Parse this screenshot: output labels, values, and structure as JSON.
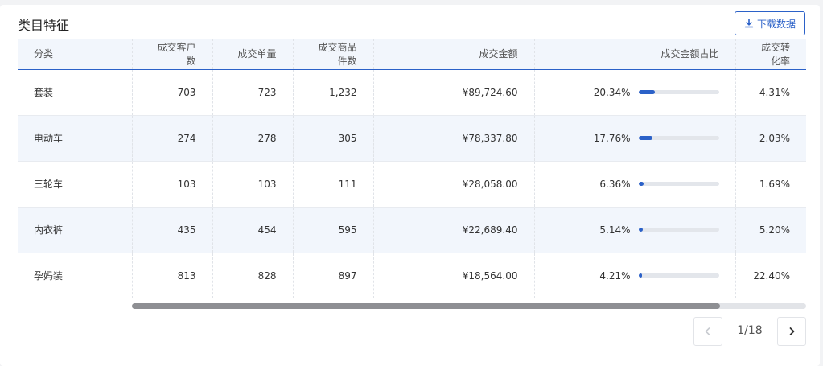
{
  "section": {
    "title": "类目特征",
    "download_label": "下载数据"
  },
  "table": {
    "columns": [
      "分类",
      "成交客户数",
      "成交单量",
      "成交商品件数",
      "成交金额",
      "成交金额占比",
      "成交转化率"
    ],
    "rows": [
      {
        "category": "套装",
        "customers": "703",
        "orders": "723",
        "items": "1,232",
        "amount": "¥89,724.60",
        "share": "20.34%",
        "share_value": 20.34,
        "conversion": "4.31%"
      },
      {
        "category": "电动车",
        "customers": "274",
        "orders": "278",
        "items": "305",
        "amount": "¥78,337.80",
        "share": "17.76%",
        "share_value": 17.76,
        "conversion": "2.03%"
      },
      {
        "category": "三轮车",
        "customers": "103",
        "orders": "103",
        "items": "111",
        "amount": "¥28,058.00",
        "share": "6.36%",
        "share_value": 6.36,
        "conversion": "1.69%"
      },
      {
        "category": "内衣裤",
        "customers": "435",
        "orders": "454",
        "items": "595",
        "amount": "¥22,689.40",
        "share": "5.14%",
        "share_value": 5.14,
        "conversion": "5.20%"
      },
      {
        "category": "孕妈装",
        "customers": "813",
        "orders": "828",
        "items": "897",
        "amount": "¥18,564.00",
        "share": "4.21%",
        "share_value": 4.21,
        "conversion": "22.40%"
      }
    ]
  },
  "pagination": {
    "text": "1/18"
  },
  "colors": {
    "accent": "#2b61c8",
    "row_alt": "#f2f6fc"
  },
  "icons": {
    "download": "download-icon",
    "prev": "chevron-left-icon",
    "next": "chevron-right-icon"
  }
}
